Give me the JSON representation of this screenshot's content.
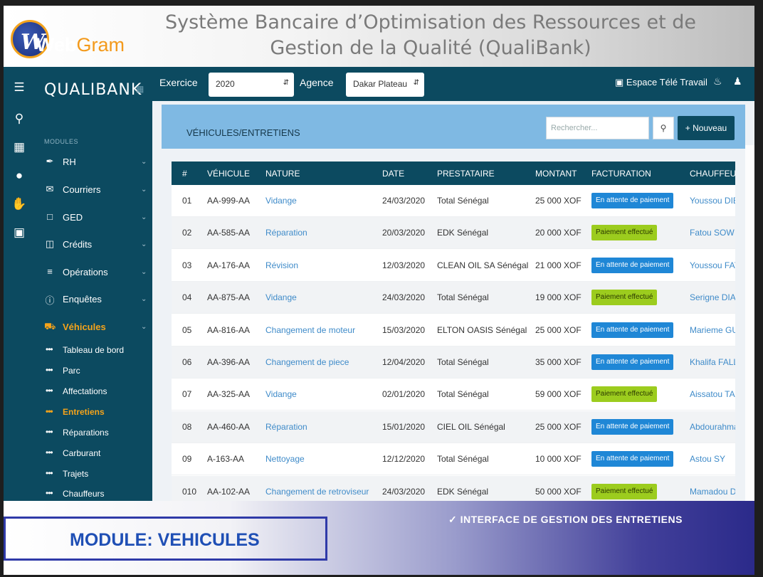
{
  "header": {
    "logo_text_a": "Web",
    "logo_text_b": "Gram",
    "title_line1": "Système Bancaire d’Optimisation des Ressources et de",
    "title_line2": "Gestion de la Qualité (QualiBank)"
  },
  "sidebar": {
    "brand": "QUALIBANK",
    "modules_label": "MODULES",
    "items": [
      {
        "label": "RH",
        "icon": "wrench-icon"
      },
      {
        "label": "Courriers",
        "icon": "envelope-icon"
      },
      {
        "label": "GED",
        "icon": "folder-icon"
      },
      {
        "label": "Crédits",
        "icon": "credit-icon"
      },
      {
        "label": "Opérations",
        "icon": "list-icon"
      },
      {
        "label": "Enquêtes",
        "icon": "question-icon"
      },
      {
        "label": "Véhicules",
        "icon": "car-icon"
      }
    ],
    "subitems": [
      "Tableau de bord",
      "Parc",
      "Affectations",
      "Entretiens",
      "Réparations",
      "Carburant",
      "Trajets",
      "Chauffeurs"
    ],
    "active_subitem": "Entretiens"
  },
  "topbar": {
    "exercice_label": "Exercice",
    "exercice_value": "2020",
    "agence_label": "Agence",
    "agence_value": "Dakar Plateau",
    "telework": "Espace Télé Travail"
  },
  "panel": {
    "title": "VÉHICULES/ENTRETIENS",
    "search_placeholder": "Rechercher...",
    "new_button": "+ Nouveau"
  },
  "table": {
    "headers": [
      "#",
      "VÉHICULE",
      "NATURE",
      "DATE",
      "PRESTATAIRE",
      "MONTANT",
      "FACTURATION",
      "CHAUFFEUR"
    ],
    "rows": [
      {
        "num": "01",
        "vehicle": "AA-999-AA",
        "nature": "Vidange",
        "date": "24/03/2020",
        "provider": "Total Sénégal",
        "amount": "25 000 XOF",
        "billing": "En attente de paiement",
        "status": "wait",
        "driver": "Youssou DIE"
      },
      {
        "num": "02",
        "vehicle": "AA-585-AA",
        "nature": "Réparation",
        "date": "20/03/2020",
        "provider": "EDK Sénégal",
        "amount": "20 000 XOF",
        "billing": "Paiement effectué",
        "status": "paid",
        "driver": "Fatou SOW"
      },
      {
        "num": "03",
        "vehicle": "AA-176-AA",
        "nature": "Révision",
        "date": "12/03/2020",
        "provider": "CLEAN OIL SA Sénégal",
        "amount": "21 000 XOF",
        "billing": "En attente de paiement",
        "status": "wait",
        "driver": "Youssou FAY"
      },
      {
        "num": "04",
        "vehicle": "AA-875-AA",
        "nature": "Vidange",
        "date": "24/03/2020",
        "provider": "Total Sénégal",
        "amount": "19 000 XOF",
        "billing": "Paiement effectué",
        "status": "paid",
        "driver": "Serigne DIAC"
      },
      {
        "num": "05",
        "vehicle": "AA-816-AA",
        "nature": "Changement de moteur",
        "date": "15/03/2020",
        "provider": "ELTON OASIS Sénégal",
        "amount": "25 000 XOF",
        "billing": "En attente de paiement",
        "status": "wait",
        "driver": "Marieme GU"
      },
      {
        "num": "06",
        "vehicle": "AA-396-AA",
        "nature": "Changement de piece",
        "date": "12/04/2020",
        "provider": "Total Sénégal",
        "amount": "35 000 XOF",
        "billing": "En attente de paiement",
        "status": "wait",
        "driver": "Khalifa FALL"
      },
      {
        "num": "07",
        "vehicle": "AA-325-AA",
        "nature": "Vidange",
        "date": "02/01/2020",
        "provider": "Total Sénégal",
        "amount": "59 000 XOF",
        "billing": "Paiement effectué",
        "status": "paid",
        "driver": "Aissatou TAL"
      },
      {
        "num": "08",
        "vehicle": "AA-460-AA",
        "nature": "Réparation",
        "date": "15/01/2020",
        "provider": "CIEL OIL Sénégal",
        "amount": "25 000 XOF",
        "billing": "En attente de paiement",
        "status": "wait",
        "driver": "Abdourahma"
      },
      {
        "num": "09",
        "vehicle": "A-163-AA",
        "nature": "Nettoyage",
        "date": "12/12/2020",
        "provider": "Total Sénégal",
        "amount": "10 000 XOF",
        "billing": "En attente de paiement",
        "status": "wait",
        "driver": "Astou SY"
      },
      {
        "num": "010",
        "vehicle": "AA-102-AA",
        "nature": "Changement de retroviseur",
        "date": "24/03/2020",
        "provider": "EDK Sénégal",
        "amount": "50 000 XOF",
        "billing": "Paiement effectué",
        "status": "paid",
        "driver": "Mamadou D"
      }
    ]
  },
  "footer": {
    "module": "MODULE: VEHICULES",
    "interface": "✓ INTERFACE DE GESTION DES ENTRETIENS"
  },
  "colors": {
    "primary": "#0c4a60",
    "accent": "#f5a31a",
    "panel": "#7fb9e3",
    "wait_badge": "#1f87d6",
    "paid_badge": "#9ccc1e",
    "link": "#3f8bc9"
  }
}
